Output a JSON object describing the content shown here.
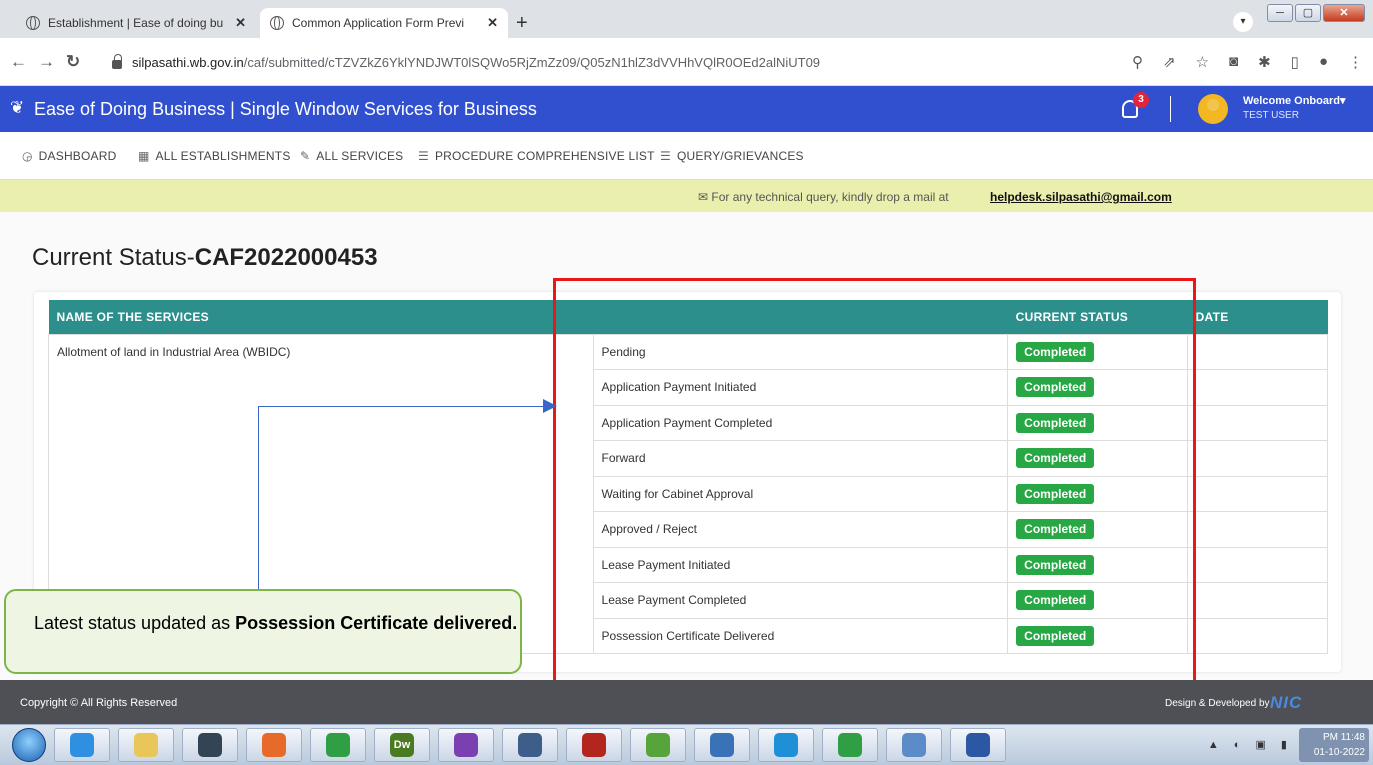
{
  "browser": {
    "tabs": [
      {
        "title": "Establishment | Ease of doing bu",
        "close": "✕"
      },
      {
        "title": "Common Application Form Previ",
        "close": "✕"
      }
    ],
    "new_tab": "+",
    "url_host": "silpasathi.wb.gov.in",
    "url_path": "/caf/submitted/cTZVZkZ6YklYNDJWT0lSQWo5RjZmZz09/Q05zN1hlZ3dVVHhVQlR0OEd2alNiUT09"
  },
  "header": {
    "title": "Ease of Doing Business | Single Window Services for Business",
    "notifications": "3",
    "welcome": "Welcome Onboard",
    "user": "TEST USER"
  },
  "menu": {
    "dashboard": "DASHBOARD",
    "establishments": "ALL ESTABLISHMENTS",
    "services": "ALL SERVICES",
    "procedure": "PROCEDURE COMPREHENSIVE LIST",
    "query": "QUERY/GRIEVANCES"
  },
  "info": {
    "text": "For any technical query, kindly drop a mail at",
    "email": "helpdesk.silpasathi@gmail.com"
  },
  "page": {
    "heading_prefix": "Current Status-",
    "caf_id": "CAF2022000453"
  },
  "table": {
    "headers": [
      "NAME OF THE SERVICES",
      "",
      "CURRENT STATUS",
      "DATE"
    ],
    "service": "Allotment of land in Industrial Area (WBIDC)",
    "rows": [
      {
        "step": "Pending",
        "status": "Completed",
        "date": ""
      },
      {
        "step": "Application Payment Initiated",
        "status": "Completed",
        "date": ""
      },
      {
        "step": "Application Payment Completed",
        "status": "Completed",
        "date": ""
      },
      {
        "step": "Forward",
        "status": "Completed",
        "date": ""
      },
      {
        "step": "Waiting for Cabinet Approval",
        "status": "Completed",
        "date": ""
      },
      {
        "step": "Approved / Reject",
        "status": "Completed",
        "date": ""
      },
      {
        "step": "Lease Payment Initiated",
        "status": "Completed",
        "date": ""
      },
      {
        "step": "Lease Payment Completed",
        "status": "Completed",
        "date": ""
      },
      {
        "step": "Possession Certificate Delivered",
        "status": "Completed",
        "date": ""
      }
    ]
  },
  "callout": {
    "text": "Latest status updated as ",
    "bold": "Possession Certificate delivered."
  },
  "footer": {
    "copyright": "Copyright © All Rights Reserved",
    "design": "Design & Developed by",
    "nic": "NIC"
  },
  "taskbar": {
    "apps": [
      "ie-icon",
      "explorer-icon",
      "media-icon",
      "firefox-icon",
      "chrome-icon",
      "dreamweaver-icon",
      "vs-icon",
      "postgres-icon",
      "filezilla-icon",
      "utorrent-icon",
      "python-icon",
      "skype-icon",
      "chrome-icon",
      "notes-icon",
      "word-icon"
    ],
    "dw_label": "Dw",
    "time": "PM 11:48",
    "date": "01-10-2022"
  },
  "colors": {
    "header_blue": "#3150d0",
    "table_header": "#2d8f8c",
    "status_green": "#28a745",
    "highlight_red": "#e81818"
  }
}
